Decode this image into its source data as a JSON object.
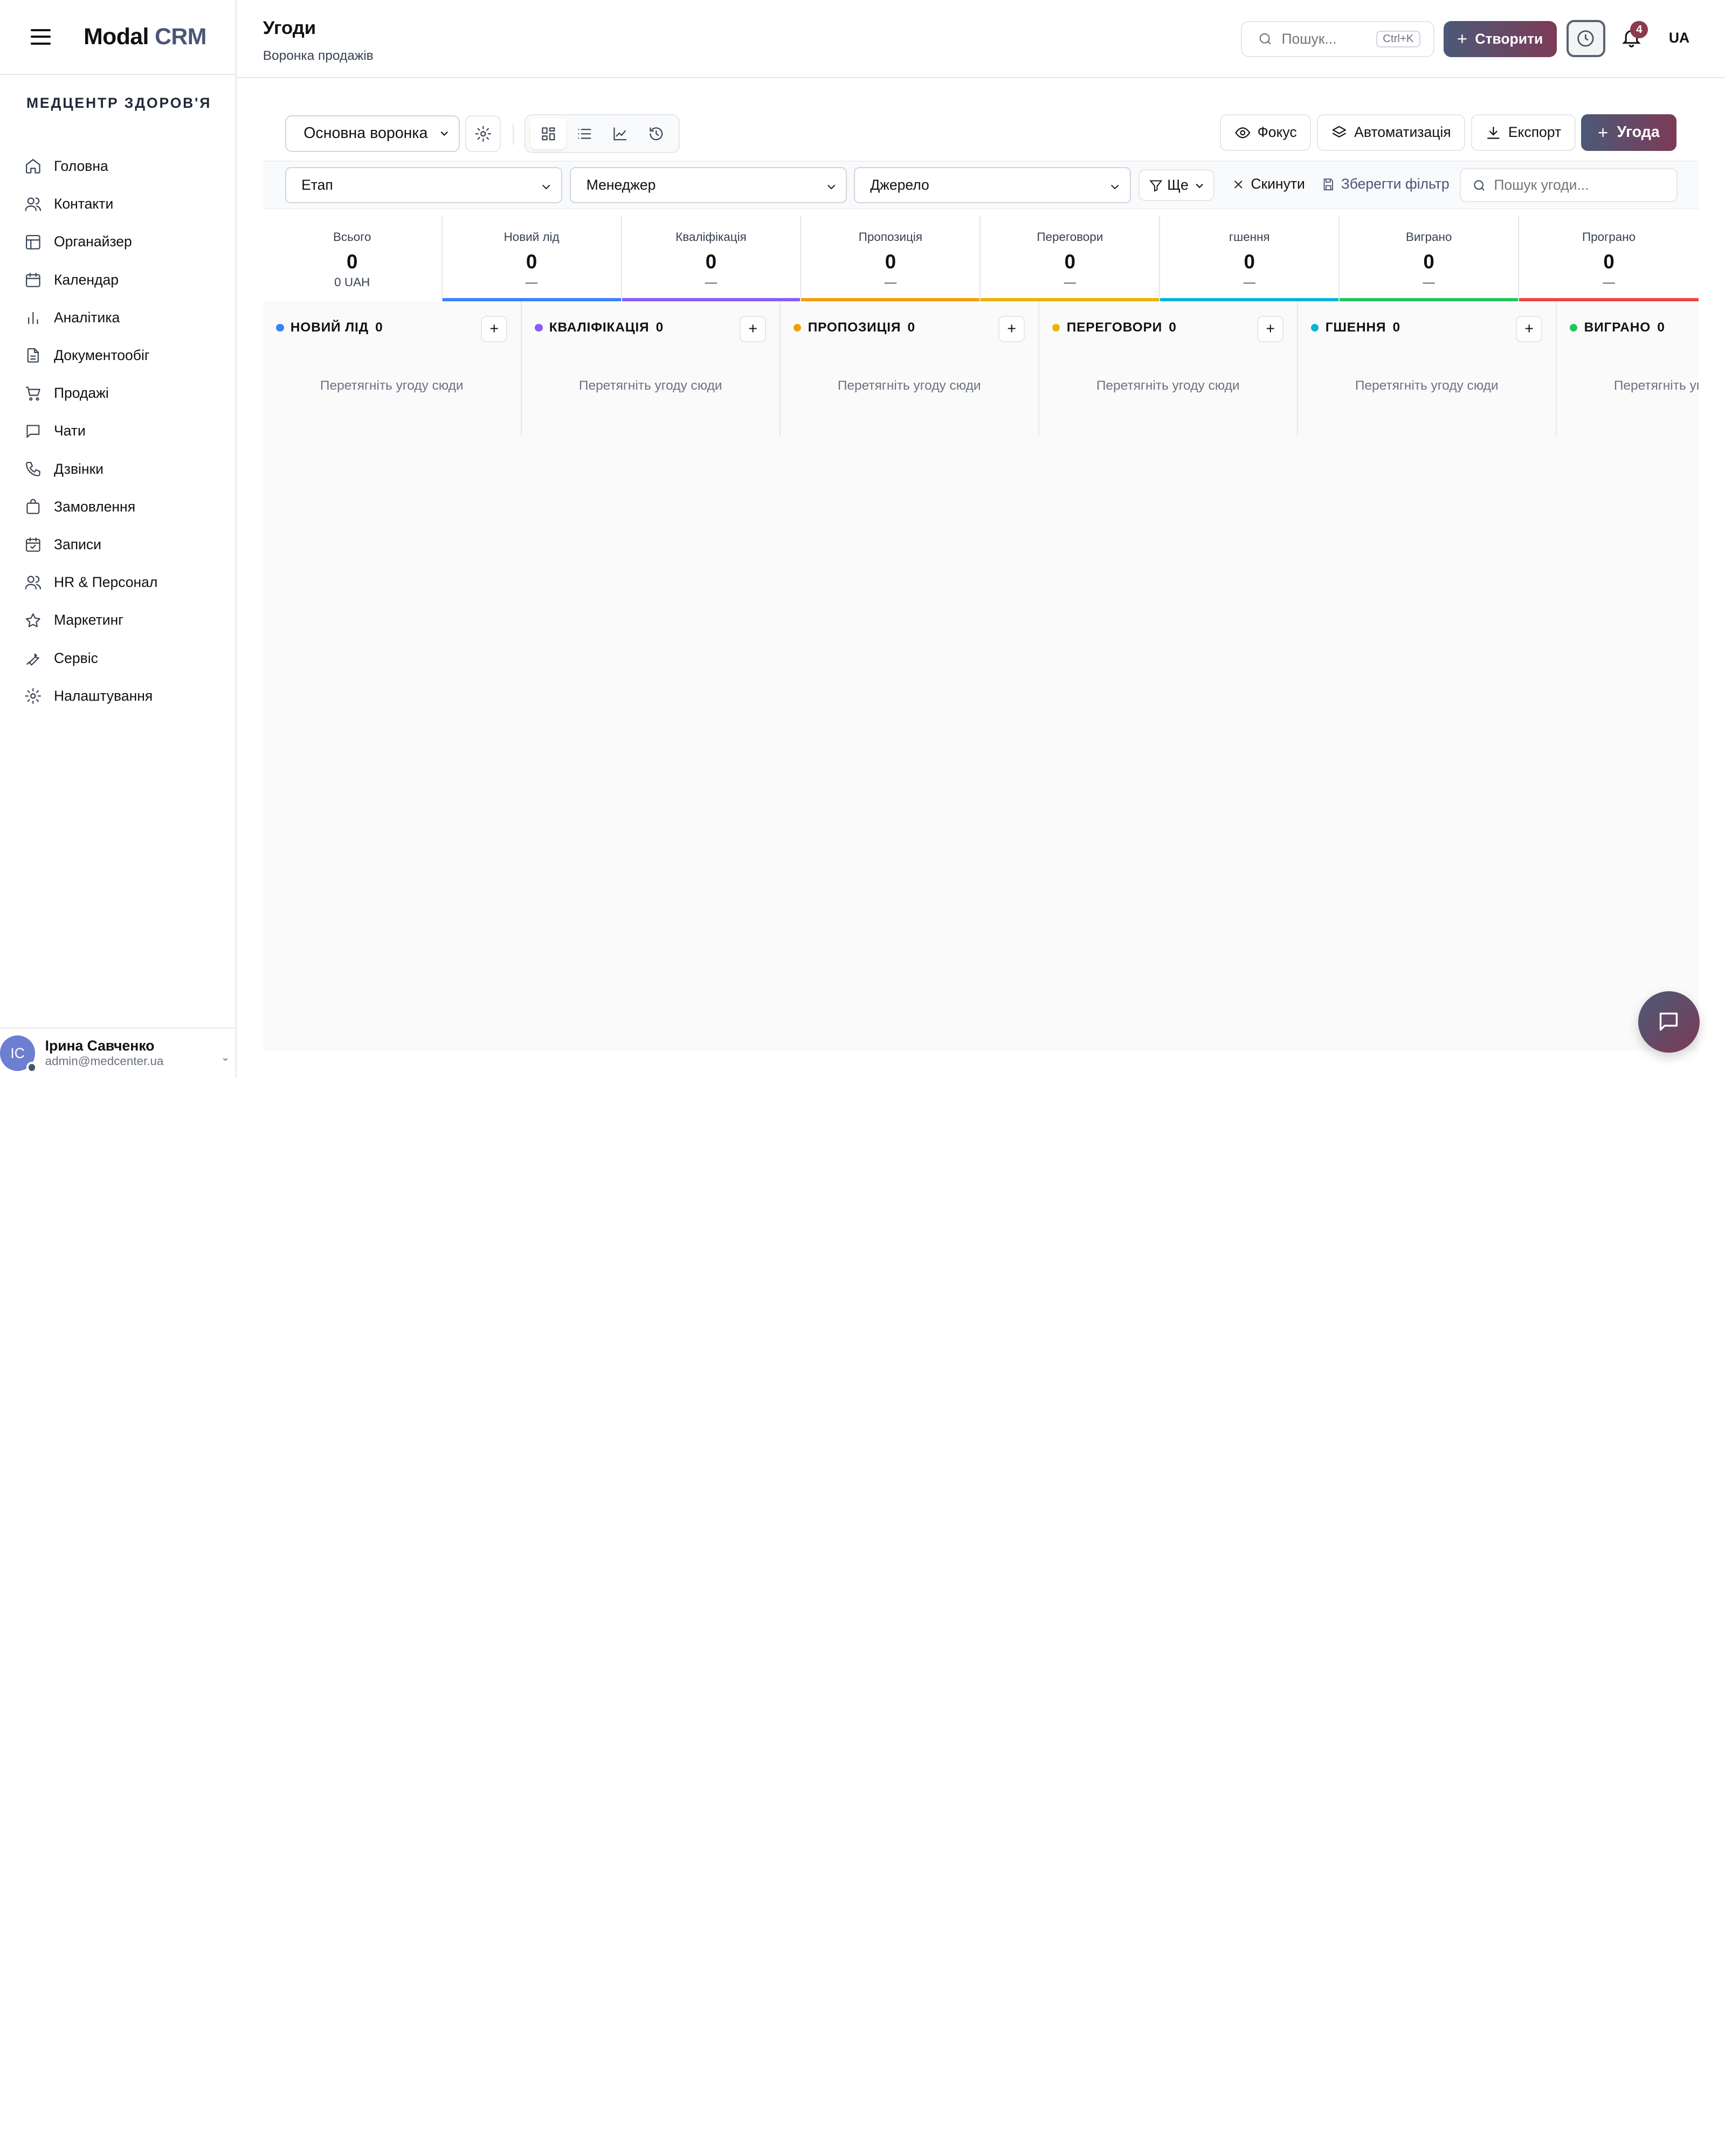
{
  "app": {
    "logo_part1": "Modal",
    "logo_part2": "CRM",
    "org_name": "МЕДЦЕНТР ЗДОРОВ'Я"
  },
  "sidebar": {
    "items": [
      {
        "label": "Головна",
        "icon": "home-icon"
      },
      {
        "label": "Контакти",
        "icon": "users-icon"
      },
      {
        "label": "Органайзер",
        "icon": "layout-icon"
      },
      {
        "label": "Календар",
        "icon": "calendar-icon"
      },
      {
        "label": "Аналітика",
        "icon": "bar-chart-icon"
      },
      {
        "label": "Документообіг",
        "icon": "document-icon"
      },
      {
        "label": "Продажі",
        "icon": "cart-icon"
      },
      {
        "label": "Чати",
        "icon": "chat-icon"
      },
      {
        "label": "Дзвінки",
        "icon": "phone-icon"
      },
      {
        "label": "Замовлення",
        "icon": "bag-icon"
      },
      {
        "label": "Записи",
        "icon": "calendar-check-icon"
      },
      {
        "label": "HR & Персонал",
        "icon": "users-icon"
      },
      {
        "label": "Маркетинг",
        "icon": "star-icon"
      },
      {
        "label": "Сервіс",
        "icon": "wrench-icon"
      },
      {
        "label": "Налаштування",
        "icon": "gear-icon"
      }
    ],
    "user": {
      "initials": "ІС",
      "name": "Ірина Савченко",
      "email": "admin@medcenter.ua"
    }
  },
  "header": {
    "title": "Угоди",
    "subtitle": "Воронка продажів",
    "search_placeholder": "Пошук...",
    "search_shortcut": "Ctrl+K",
    "create_label": "Створити",
    "notifications_count": "4",
    "language": "UA"
  },
  "toolbar": {
    "pipeline_selected": "Основна воронка",
    "focus_label": "Фокус",
    "automation_label": "Автоматизація",
    "export_label": "Експорт",
    "deal_label": "Угода"
  },
  "filters": {
    "stage": "Етап",
    "manager": "Менеджер",
    "source": "Джерело",
    "more_label": "Ще",
    "reset_label": "Скинути",
    "save_label": "Зберегти фільтр",
    "search_placeholder": "Пошук угоди..."
  },
  "stats": [
    {
      "label": "Всього",
      "value": "0",
      "sub": "0 UAH",
      "color": ""
    },
    {
      "label": "Новий лід",
      "value": "0",
      "sub": "—",
      "color": "#3b82f6"
    },
    {
      "label": "Кваліфікація",
      "value": "0",
      "sub": "—",
      "color": "#8b5cf6"
    },
    {
      "label": "Пропозиція",
      "value": "0",
      "sub": "—",
      "color": "#f59e0b"
    },
    {
      "label": "Переговори",
      "value": "0",
      "sub": "—",
      "color": "#eab308"
    },
    {
      "label": "гшення",
      "value": "0",
      "sub": "—",
      "color": "#06b6d4"
    },
    {
      "label": "Виграно",
      "value": "0",
      "sub": "—",
      "color": "#22c55e"
    },
    {
      "label": "Програно",
      "value": "0",
      "sub": "—",
      "color": "#ef4444"
    }
  ],
  "columns": [
    {
      "title": "НОВИЙ ЛІД",
      "count": "0",
      "color": "#3b82f6",
      "empty": "Перетягніть угоду сюди"
    },
    {
      "title": "КВАЛІФІКАЦІЯ",
      "count": "0",
      "color": "#8b5cf6",
      "empty": "Перетягніть угоду сюди"
    },
    {
      "title": "ПРОПОЗИЦІЯ",
      "count": "0",
      "color": "#f59e0b",
      "empty": "Перетягніть угоду сюди"
    },
    {
      "title": "ПЕРЕГОВОРИ",
      "count": "0",
      "color": "#eab308",
      "empty": "Перетягніть угоду сюди"
    },
    {
      "title": "ГШЕННЯ",
      "count": "0",
      "color": "#06b6d4",
      "empty": "Перетягніть угоду сюди"
    },
    {
      "title": "ВИГРАНО",
      "count": "0",
      "color": "#22c55e",
      "empty": "Перетягніть угоду сюди"
    }
  ]
}
